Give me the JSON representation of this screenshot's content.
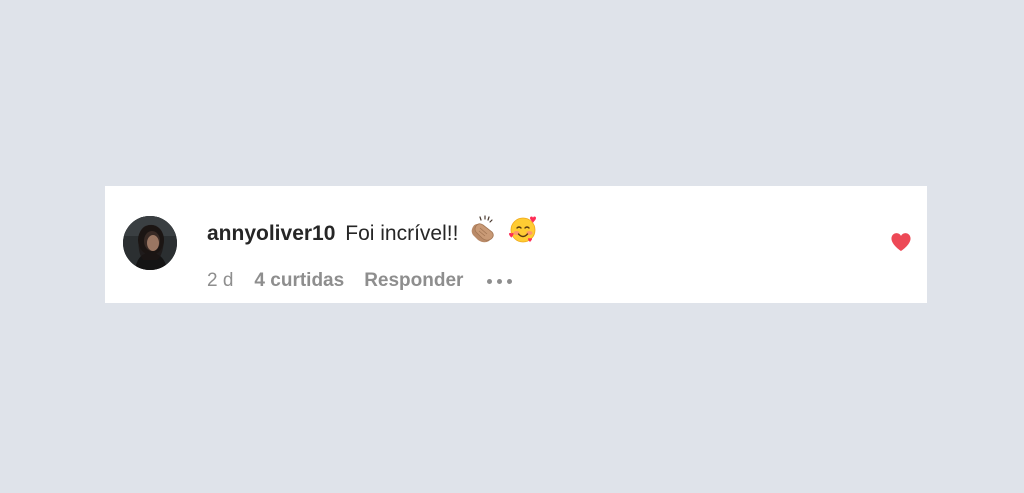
{
  "comment": {
    "username": "annyoliver10",
    "text": "Foi incrível!!",
    "emojis": [
      "clapping-hands-medium-skin-tone",
      "smiling-face-with-hearts"
    ],
    "time": "2 d",
    "likes": "4 curtidas",
    "reply_label": "Responder",
    "liked": true,
    "like_color": "#ed4956"
  }
}
